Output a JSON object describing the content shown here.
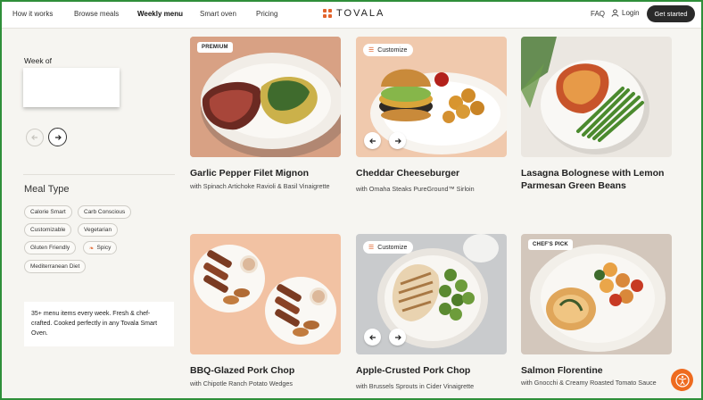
{
  "nav": {
    "links": [
      "How it works",
      "Browse meals",
      "Weekly menu",
      "Smart oven",
      "Pricing"
    ],
    "active": "Weekly menu",
    "brand": "TOVALA",
    "faq": "FAQ",
    "login": "Login",
    "cta": "Get started",
    "brand_color": "#e2632b"
  },
  "sidebar": {
    "week_label": "Week of",
    "meal_type_title": "Meal Type",
    "chips": [
      "Calorie Smart",
      "Carb Conscious",
      "Customizable",
      "Vegetarian",
      "Gluten Friendly",
      "Spicy",
      "Mediterranean Diet"
    ],
    "info": "35+ menu items every week. Fresh & chef-crafted. Cooked perfectly in any Tovala Smart Oven."
  },
  "meals": [
    {
      "title": "Garlic Pepper Filet Mignon",
      "sub": "with Spinach Artichoke Ravioli & Basil Vinaigrette",
      "badge": "PREMIUM"
    },
    {
      "title": "Cheddar Cheeseburger",
      "sub": "with Omaha Steaks PureGround™ Sirloin",
      "badge": "Customize"
    },
    {
      "title": "Lasagna Bolognese with Lemon Parmesan Green Beans",
      "sub": ""
    },
    {
      "title": "BBQ-Glazed Pork Chop",
      "sub": "with Chipotle Ranch Potato Wedges"
    },
    {
      "title": "Apple-Crusted Pork Chop",
      "sub": "with Brussels Sprouts in Cider Vinaigrette",
      "badge": "Customize"
    },
    {
      "title": "Salmon Florentine",
      "sub": "with Gnocchi & Creamy Roasted Tomato Sauce",
      "badge": "CHEF'S PICK"
    }
  ],
  "icons": {
    "prev": "arrow-left-icon",
    "next": "arrow-right-icon",
    "customize": "sliders-icon",
    "spicy": "chili-icon",
    "login": "person-icon",
    "accessibility": "accessibility-icon"
  }
}
